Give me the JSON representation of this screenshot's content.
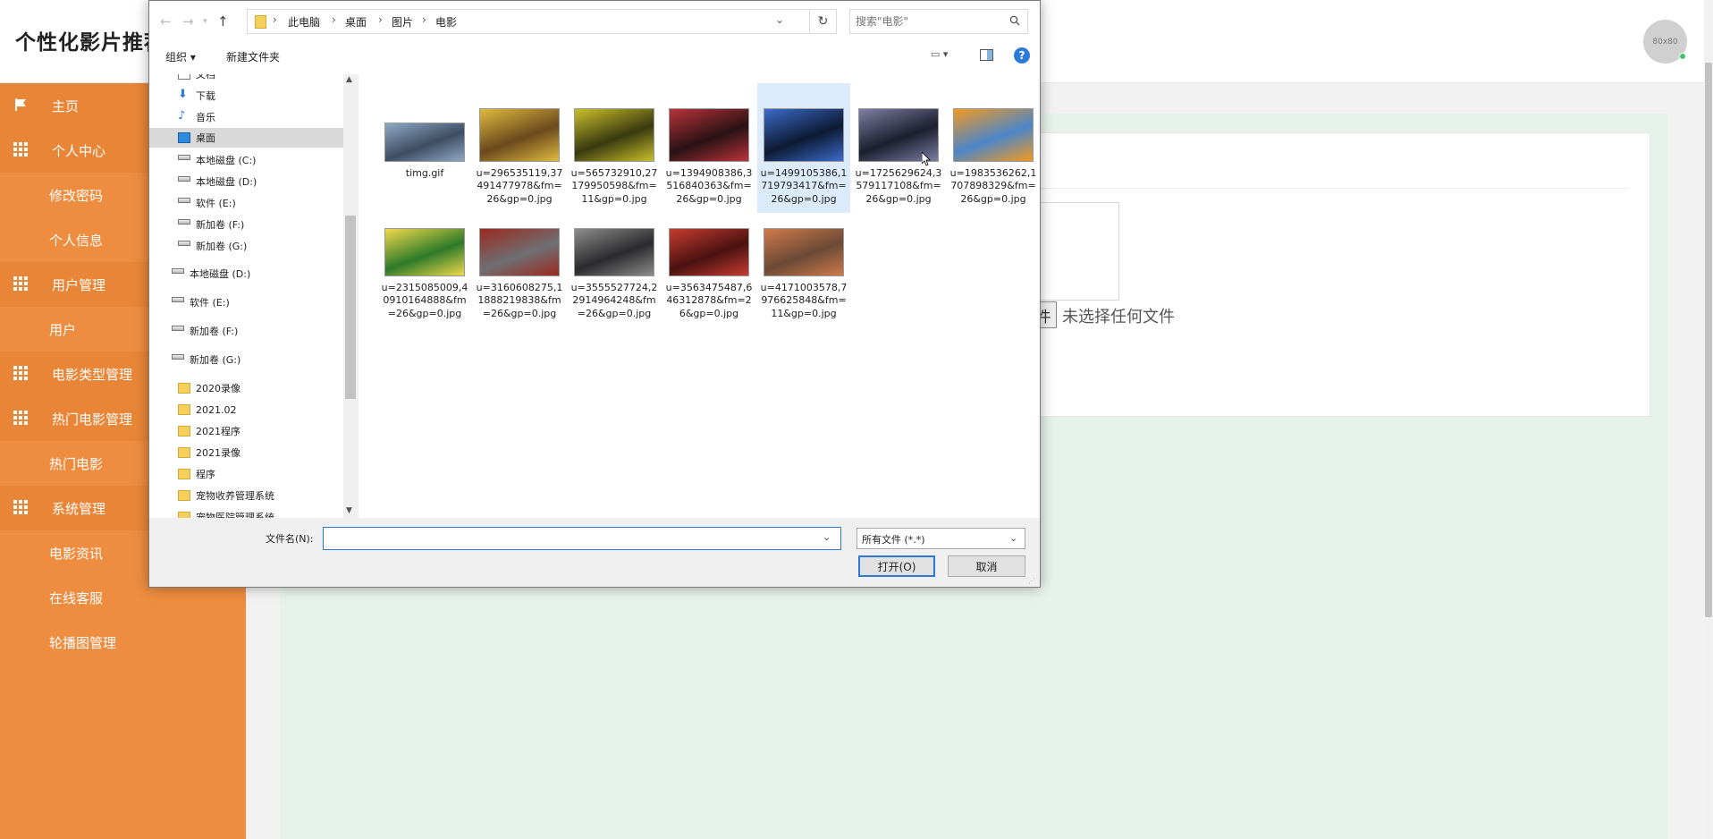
{
  "app": {
    "title": "个性化影片推荐",
    "avatar_text": "80x80",
    "sidebar": [
      {
        "label": "主页",
        "icon": "flag-icon",
        "group": true
      },
      {
        "label": "个人中心",
        "icon": "grid-icon",
        "group": true
      },
      {
        "label": "修改密码",
        "group": false
      },
      {
        "label": "个人信息",
        "group": false
      },
      {
        "label": "用户管理",
        "icon": "grid-icon",
        "group": true
      },
      {
        "label": "用户",
        "group": false
      },
      {
        "label": "电影类型管理",
        "icon": "grid-icon",
        "group": true
      },
      {
        "label": "热门电影管理",
        "icon": "grid-icon",
        "group": true
      },
      {
        "label": "热门电影",
        "group": false
      },
      {
        "label": "系统管理",
        "icon": "grid-icon",
        "group": true
      },
      {
        "label": "电影资讯",
        "group": false
      },
      {
        "label": "在线客服",
        "group": false
      },
      {
        "label": "轮播图管理",
        "group": false
      }
    ],
    "choose_file_label": "件",
    "no_file_text": "未选择任何文件"
  },
  "dialog": {
    "breadcrumbs": [
      "此电脑",
      "桌面",
      "图片",
      "电影"
    ],
    "search_placeholder": "搜索\"电影\"",
    "toolbar": {
      "organize": "组织 ▾",
      "new_folder": "新建文件夹"
    },
    "tree": [
      {
        "label": "文档",
        "icon": "doc-icon",
        "indent": 1
      },
      {
        "label": "下载",
        "icon": "download-icon",
        "indent": 1
      },
      {
        "label": "音乐",
        "icon": "music-icon",
        "indent": 1
      },
      {
        "label": "桌面",
        "icon": "desktop-icon",
        "indent": 1,
        "selected": true
      },
      {
        "label": "本地磁盘 (C:)",
        "icon": "drive-icon",
        "indent": 1
      },
      {
        "label": "本地磁盘 (D:)",
        "icon": "drive-icon",
        "indent": 1
      },
      {
        "label": "软件 (E:)",
        "icon": "drive-icon",
        "indent": 1
      },
      {
        "label": "新加卷 (F:)",
        "icon": "drive-icon",
        "indent": 1
      },
      {
        "label": "新加卷 (G:)",
        "icon": "drive-icon",
        "indent": 1
      },
      {
        "label": "本地磁盘 (D:)",
        "icon": "drive-icon",
        "indent": 0
      },
      {
        "label": "软件 (E:)",
        "icon": "drive-icon",
        "indent": 0
      },
      {
        "label": "新加卷 (F:)",
        "icon": "drive-icon",
        "indent": 0
      },
      {
        "label": "新加卷 (G:)",
        "icon": "drive-icon",
        "indent": 0
      },
      {
        "label": "2020录像",
        "icon": "folder-icon",
        "indent": 1
      },
      {
        "label": "2021.02",
        "icon": "folder-icon",
        "indent": 1
      },
      {
        "label": "2021程序",
        "icon": "folder-icon",
        "indent": 1
      },
      {
        "label": "2021录像",
        "icon": "folder-icon",
        "indent": 1
      },
      {
        "label": "程序",
        "icon": "folder-icon",
        "indent": 1
      },
      {
        "label": "宠物收养管理系统",
        "icon": "folder-icon",
        "indent": 1
      },
      {
        "label": "宠物医院管理系统",
        "icon": "folder-icon",
        "indent": 1
      }
    ],
    "files": [
      {
        "name": "timg.gif",
        "color": "#3d4e63",
        "accent": "#8fa9c4"
      },
      {
        "name": "u=296535119,37491477978&fm=26&gp=0.jpg",
        "color": "#6b4a1d",
        "accent": "#e0b93e"
      },
      {
        "name": "u=565732910,27179950598&fm=11&gp=0.jpg",
        "color": "#3a3a10",
        "accent": "#c9c02b"
      },
      {
        "name": "u=1394908386,3516840363&fm=26&gp=0.jpg",
        "color": "#2a1214",
        "accent": "#b8333c"
      },
      {
        "name": "u=1499105386,1719793417&fm=26&gp=0.jpg",
        "color": "#0d1a33",
        "accent": "#3b6bc9"
      },
      {
        "name": "u=1725629624,3579117108&fm=26&gp=0.jpg",
        "color": "#1b1f2e",
        "accent": "#7d7fa2"
      },
      {
        "name": "u=1983536262,1707898329&fm=26&gp=0.jpg",
        "color": "#4c86c9",
        "accent": "#f29a1f"
      },
      {
        "name": "u=2315085009,40910164888&fm=26&gp=0.jpg",
        "color": "#2e7a2a",
        "accent": "#f0d94a"
      },
      {
        "name": "u=3160608275,11888219838&fm=26&gp=0.jpg",
        "color": "#6f6f73",
        "accent": "#9b2a20"
      },
      {
        "name": "u=3555527724,22914964248&fm=26&gp=0.jpg",
        "color": "#2b2b2d",
        "accent": "#8d8d8d"
      },
      {
        "name": "u=3563475487,646312878&fm=26&gp=0.jpg",
        "color": "#4a1211",
        "accent": "#c73c30"
      },
      {
        "name": "u=4171003578,7976625848&fm=11&gp=0.jpg",
        "color": "#6b4a36",
        "accent": "#d07a4a"
      }
    ],
    "filename_label": "文件名(N):",
    "filename_value": "",
    "filetype": "所有文件 (*.*)",
    "open_label": "打开(O)",
    "cancel_label": "取消",
    "help": "?"
  }
}
